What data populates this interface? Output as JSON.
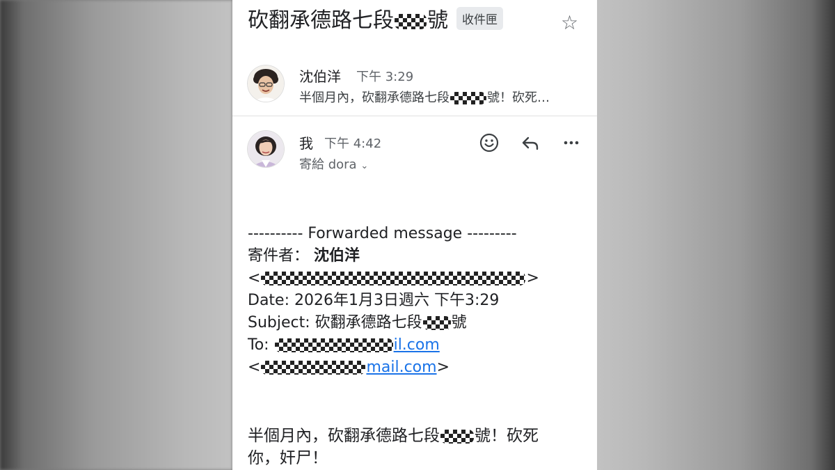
{
  "thread": {
    "subject_prefix": "砍翻承德路七段",
    "subject_suffix": "號",
    "folder_badge": "收件匣"
  },
  "message1": {
    "sender": "沈伯洋",
    "time": "下午 3:29",
    "snippet_prefix": "半個月內，砍翻承德路七段",
    "snippet_suffix": "號！砍死…"
  },
  "message2": {
    "sender": "我",
    "time": "下午 4:42",
    "to_label": "寄給 dora",
    "icons": [
      "emoji-icon",
      "reply-icon",
      "more-icon"
    ]
  },
  "forwarded": {
    "header": "---------- Forwarded message ---------",
    "from_label": "寄件者：",
    "from_name": "沈伯洋",
    "from_email_open": "<",
    "from_email_close": ">",
    "date_line": "Date: 2026年1月3日週六 下午3:29",
    "subject_label": "Subject: 砍翻承德路七段",
    "subject_suffix": "號",
    "to_label": "To: ",
    "to_email_visible": "il.com",
    "cc_open": "<",
    "cc_visible": "mail.com",
    "cc_close": ">"
  },
  "body": {
    "line1_prefix": "半個月內，砍翻承德路七段",
    "line1_suffix": "號！砍死",
    "line2": "你，奸尸！"
  }
}
